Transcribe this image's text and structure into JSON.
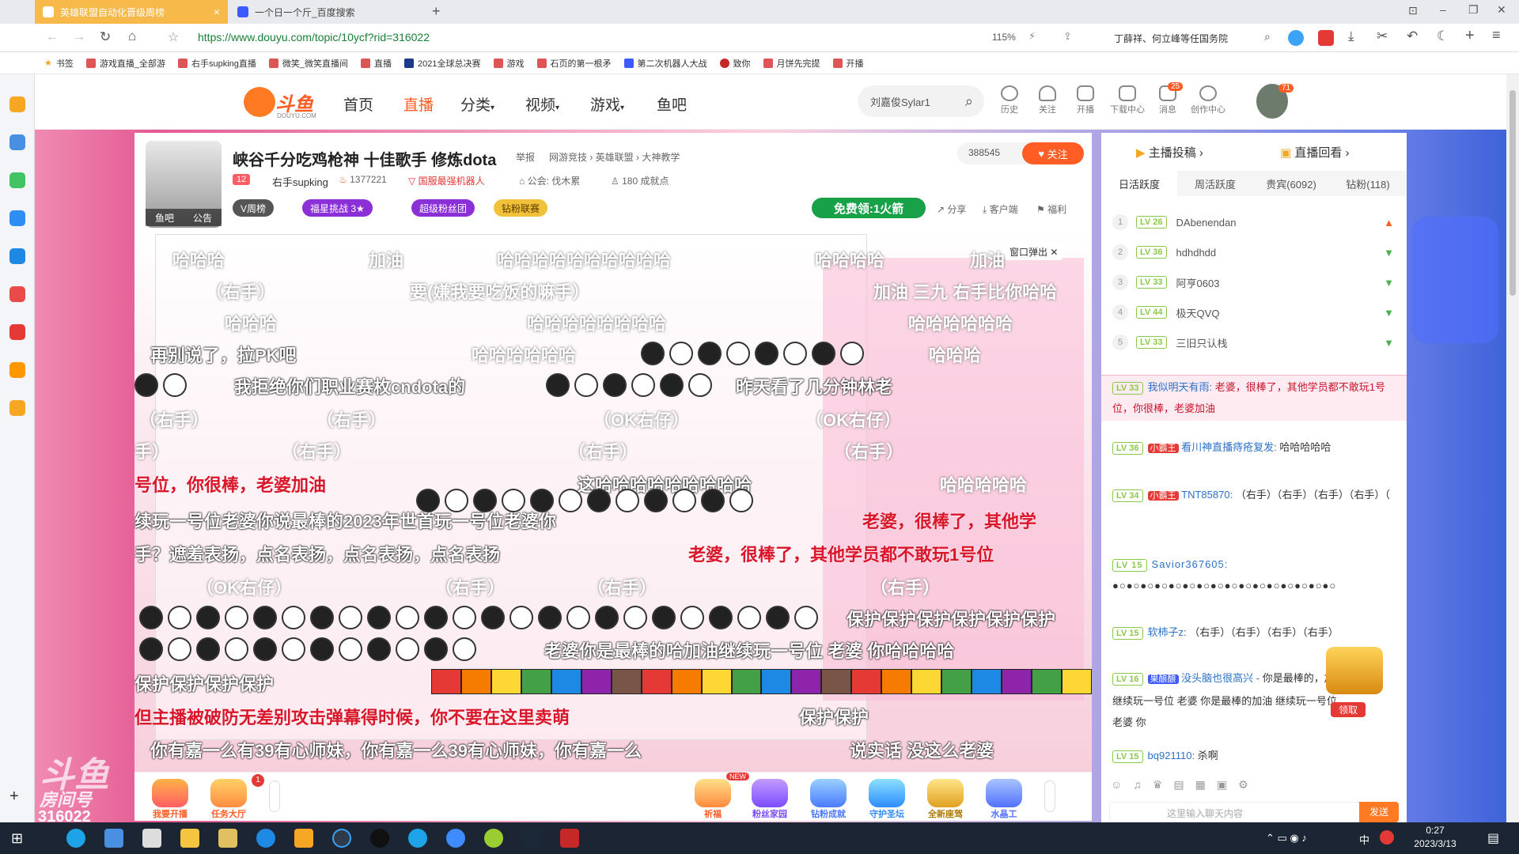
{
  "browser": {
    "tabs": [
      {
        "title": "英雄联盟自动化晋级周榜",
        "active": true
      },
      {
        "title": "一个日一个斤_百度搜索",
        "active": false
      }
    ],
    "new_tab": "+",
    "url": "https://www.douyu.com/topic/10ycf?rid=316022",
    "zoom": "115%",
    "news_search": "丁薛祥、何立峰等任国务院",
    "bookmarks": [
      "书签",
      "游戏直播_全部游",
      "右手supking直播",
      "微笑_微笑直播间",
      "直播",
      "2021全球总决赛",
      "游戏",
      "石页的第一根矛",
      "第二次机器人大战",
      "致你",
      "月饼先完提",
      "开播"
    ]
  },
  "site": {
    "logo": "斗鱼",
    "logo_sub": "DOUYU.COM",
    "nav": [
      "首页",
      "直播",
      "分类",
      "视频",
      "游戏",
      "鱼吧"
    ],
    "nav_active": "直播",
    "search_value": "刘嘉俊Sylar1",
    "header_icons": [
      {
        "name": "history",
        "label": "历史"
      },
      {
        "name": "follow",
        "label": "关注"
      },
      {
        "name": "broadcast",
        "label": "开播"
      },
      {
        "name": "download",
        "label": "下载中心"
      },
      {
        "name": "message",
        "label": "消息",
        "badge": "25"
      },
      {
        "name": "create",
        "label": "创作中心"
      }
    ],
    "avatar_badge": "71"
  },
  "room": {
    "title": "峡谷千分吃鸡枪神 十佳歌手 修炼dota",
    "report": "举报",
    "category": "网游竞技 › 英雄联盟 › 大神教学",
    "level_badge": "12",
    "streamer": "右手supking",
    "heat": "1377221",
    "honor": "国服最强机器人",
    "guild": "公会: 伐木累",
    "achievements": "180 成就点",
    "followers": "388545",
    "follow_btn": "关注",
    "avatar_tabs": [
      "鱼吧",
      "公告"
    ],
    "pills": [
      "V周榜",
      "福星挑战 3★",
      "超级粉丝团",
      "钻粉联赛"
    ],
    "free_gift": "免费领:1火箭",
    "actions": [
      "分享",
      "客户端",
      "福利"
    ],
    "popout": "窗口弹出",
    "room_label": "房间号",
    "room_id": "316022"
  },
  "danmaku": [
    {
      "text": "哈哈哈",
      "style": "gray"
    },
    {
      "text": "加油",
      "style": "gray"
    },
    {
      "text": "哈哈哈哈哈哈哈哈哈哈",
      "style": "gray"
    },
    {
      "text": "哈哈哈哈",
      "style": "gray"
    },
    {
      "text": "加油",
      "style": "gray"
    },
    {
      "text": "（右手）",
      "style": "gray"
    },
    {
      "text": "要(嫌我要吃饭的嘛手）",
      "style": "gray"
    },
    {
      "text": "加油 三九 右手比你哈哈",
      "style": "gray"
    },
    {
      "text": "哈哈哈",
      "style": "gray"
    },
    {
      "text": "哈哈哈哈哈哈哈哈",
      "style": "gray"
    },
    {
      "text": "哈哈哈哈哈哈",
      "style": "gray"
    },
    {
      "text": "再别说了，拉PK吧",
      "style": "white"
    },
    {
      "text": "哈哈哈哈哈哈",
      "style": "gray"
    },
    {
      "text": "哈哈哈",
      "style": "gray"
    },
    {
      "text": "我拒绝你们职业赛枚cndota的",
      "style": "white"
    },
    {
      "text": "昨天看了几分钟林老",
      "style": "white"
    },
    {
      "text": "（右手）",
      "style": "gray"
    },
    {
      "text": "（右手）",
      "style": "gray"
    },
    {
      "text": "（OK右仔）",
      "style": "gray"
    },
    {
      "text": "（OK右仔）",
      "style": "gray"
    },
    {
      "text": "手）",
      "style": "gray"
    },
    {
      "text": "（右手）",
      "style": "gray"
    },
    {
      "text": "（右手）",
      "style": "gray"
    },
    {
      "text": "（右手）",
      "style": "gray"
    },
    {
      "text": "号位，你很棒，老婆加油",
      "style": "red"
    },
    {
      "text": "这哈哈哈哈哈哈哈哈哈",
      "style": "white"
    },
    {
      "text": "哈哈哈哈哈",
      "style": "white"
    },
    {
      "text": "续玩一号位老婆你说最棒的2023年世首玩一号位老婆你",
      "style": "white"
    },
    {
      "text": "老婆，很棒了，其他学",
      "style": "red"
    },
    {
      "text": "手？遮羞表扬，点名表扬，点名表扬，点名表扬",
      "style": "white"
    },
    {
      "text": "老婆，很棒了，其他学员都不敢玩1号位",
      "style": "red"
    },
    {
      "text": "（OK右仔）",
      "style": "gray"
    },
    {
      "text": "（右手）",
      "style": "gray"
    },
    {
      "text": "（右手）",
      "style": "gray"
    },
    {
      "text": "（右手）",
      "style": "gray"
    },
    {
      "text": "保护保护保护保护保护保护",
      "style": "white"
    },
    {
      "text": "老婆你是最棒的哈加油继续玩一号位 老婆 你哈哈哈哈",
      "style": "white"
    },
    {
      "text": "保护保护保护保护",
      "style": "white"
    },
    {
      "text": "但主播被破防无差别攻击弹幕得时候，你不要在这里卖萌",
      "style": "red"
    },
    {
      "text": "保护保护",
      "style": "white"
    },
    {
      "text": "你有嘉一么有39有心师妹，你有嘉一么39有心师妹，你有嘉一么",
      "style": "white"
    },
    {
      "text": "说实话 没这么老婆",
      "style": "white"
    }
  ],
  "bottom_bar": [
    "我要开播",
    "任务大厅",
    "祈福",
    "粉丝家园",
    "钻粉成就",
    "守护圣坛",
    "全新座驾",
    "水晶工"
  ],
  "bottom_new_badge": "NEW",
  "task_badge": "1",
  "chat": {
    "top_tabs": [
      "主播投稿",
      "直播回看"
    ],
    "rank_tabs": [
      "日活跃度",
      "周活跃度",
      "贵宾(6092)",
      "钻粉(118)"
    ],
    "ranking": [
      {
        "rank": "1",
        "level": "LV 26",
        "name": "DAbenendan",
        "trend": "up"
      },
      {
        "rank": "2",
        "level": "LV 36",
        "name": "hdhdhdd",
        "trend": "down"
      },
      {
        "rank": "3",
        "level": "LV 33",
        "name": "阿亨0603",
        "trend": "down"
      },
      {
        "rank": "4",
        "level": "LV 44",
        "name": "极天QVQ",
        "trend": "down"
      },
      {
        "rank": "5",
        "level": "LV 33",
        "name": "三旧只认栈",
        "trend": "down"
      }
    ],
    "highlight": {
      "level": "LV 33",
      "name": "我似明天有雨:",
      "text": "老婆，很棒了，其他学员都不敢玩1号位，你很棒，老婆加油"
    },
    "messages": [
      {
        "level": "LV 36",
        "badge": "小霸王",
        "name": "看川神直播痔疮复发:",
        "text": "哈哈哈哈哈"
      },
      {
        "level": "LV 34",
        "badge": "小霸王",
        "name": "TNT85870:",
        "text": "（右手）（右手）（右手）（右手）（"
      },
      {
        "level": "LV 15",
        "badge": "",
        "name": "Savior367605:",
        "text": "●○●○●○●○●○●○●○●○●○●○●○●○●○●○●○●○"
      },
      {
        "level": "LV 15",
        "badge": "",
        "name": "软柿子z:",
        "text": "（右手）（右手）（右手）（右手）"
      },
      {
        "level": "LV 16",
        "badge": "果酿酿",
        "name": "没头脑也很高兴 -",
        "text": "你是最棒的，加油 继续玩一号位 老婆 你是最棒的加油 继续玩一号位 老婆 你"
      },
      {
        "level": "LV 15",
        "badge": "",
        "name": "bq921110:",
        "text": "杀啊"
      }
    ],
    "claim_btn": "领取",
    "input_placeholder": "这里输入聊天内容",
    "send_btn": "发送"
  },
  "taskbar": {
    "time": "0:27",
    "date": "2023/3/13",
    "ime": "中"
  }
}
